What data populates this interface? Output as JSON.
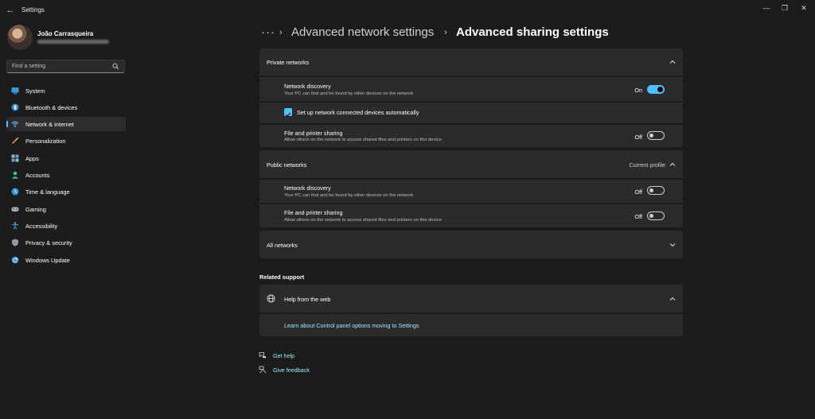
{
  "window": {
    "title": "Settings",
    "minimize": "—",
    "maximize": "❐",
    "close": "✕"
  },
  "user": {
    "name": "João Carrasqueira"
  },
  "search": {
    "placeholder": "Find a setting"
  },
  "sidebar": {
    "items": [
      {
        "label": "System"
      },
      {
        "label": "Bluetooth & devices"
      },
      {
        "label": "Network & internet"
      },
      {
        "label": "Personalization"
      },
      {
        "label": "Apps"
      },
      {
        "label": "Accounts"
      },
      {
        "label": "Time & language"
      },
      {
        "label": "Gaming"
      },
      {
        "label": "Accessibility"
      },
      {
        "label": "Privacy & security"
      },
      {
        "label": "Windows Update"
      }
    ],
    "active_index": 2
  },
  "breadcrumb": {
    "overflow": "···",
    "separator": "›",
    "parent": "Advanced network settings",
    "current": "Advanced sharing settings"
  },
  "private_networks": {
    "title": "Private networks",
    "discovery": {
      "title": "Network discovery",
      "description": "Your PC can find and be found by other devices on the network",
      "state": "On"
    },
    "auto_setup": {
      "label": "Set up network connected devices automatically",
      "checked": true
    },
    "file_sharing": {
      "title": "File and printer sharing",
      "description": "Allow others on the network to access shared files and printers on this device",
      "state": "Off"
    }
  },
  "public_networks": {
    "title": "Public networks",
    "badge": "Current profile",
    "discovery": {
      "title": "Network discovery",
      "description": "Your PC can find and be found by other devices on the network",
      "state": "Off"
    },
    "file_sharing": {
      "title": "File and printer sharing",
      "description": "Allow others on the network to access shared files and printers on this device",
      "state": "Off"
    }
  },
  "all_networks": {
    "title": "All networks"
  },
  "related_support": {
    "title": "Related support",
    "help_web": "Help from the web",
    "link": "Learn about Control panel options moving to Settings"
  },
  "footer": {
    "get_help": "Get help",
    "give_feedback": "Give feedback"
  },
  "colors": {
    "background": "#1c1c1c",
    "card": "#2b2b2b",
    "accent": "#4cc2ff",
    "link": "#99ebff"
  }
}
